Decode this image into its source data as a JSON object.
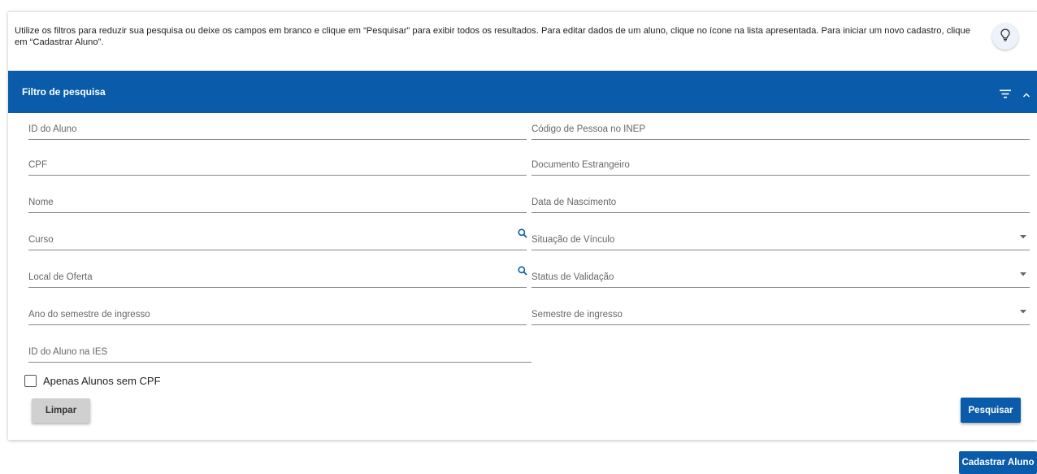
{
  "instructions": "Utilize os filtros para reduzir sua pesquisa ou deixe os campos em branco e clique em “Pesquisar” para exibir todos os resultados. Para editar dados de um aluno, clique no ícone na lista apresentada. Para iniciar um novo cadastro, clique em “Cadastrar Aluno”.",
  "filter": {
    "title": "Filtro de pesquisa",
    "fields": {
      "id_aluno": "ID do Aluno",
      "codigo_inep": "Código de Pessoa no INEP",
      "cpf": "CPF",
      "documento_estrangeiro": "Documento Estrangeiro",
      "nome": "Nome",
      "data_nascimento": "Data de Nascimento",
      "curso": "Curso",
      "situacao_vinculo": "Situação de Vínculo",
      "local_oferta": "Local de Oferta",
      "status_validacao": "Status de Validação",
      "ano_semestre_ingresso": "Ano do semestre de ingresso",
      "semestre_ingresso": "Semestre de ingresso",
      "id_aluno_ies": "ID do Aluno na IES"
    },
    "checkbox_label": "Apenas Alunos sem CPF",
    "checkbox_checked": false,
    "clear_label": "Limpar",
    "search_label": "Pesquisar"
  },
  "new_student_label": "Cadastrar Aluno",
  "colors": {
    "primary": "#0a5cab",
    "secondary_button": "#d0d0d0",
    "icon_accent": "#0a5cab"
  },
  "icons": {
    "hint": "lightbulb-icon",
    "filter": "filter-list-icon",
    "collapse": "chevron-up-icon",
    "field_search": "search-icon",
    "dropdown": "caret-down-icon"
  }
}
